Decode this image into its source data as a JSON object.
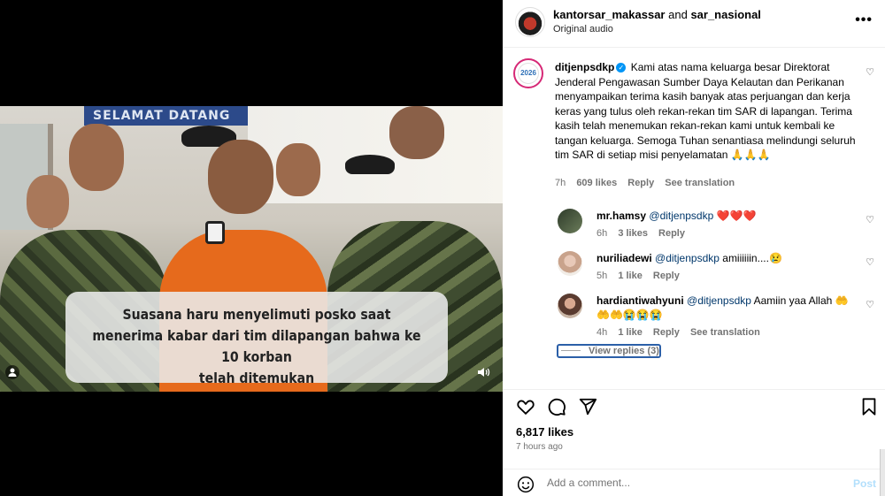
{
  "video": {
    "banner_text": "SELAMAT DATANG",
    "caption_lines": [
      "Suasana haru menyelimuti posko saat",
      "menerima kabar dari tim dilapangan bahwa ke 10 korban",
      "telah ditemukan"
    ],
    "user_tag_icon": "user-icon",
    "audio_icon": "speaker-icon"
  },
  "header": {
    "user1": "kantorsar_makassar",
    "joiner": "and",
    "user2": "sar_nasional",
    "subtitle": "Original audio",
    "more_icon": "more-icon"
  },
  "main_comment": {
    "username": "ditjenpsdkp",
    "avatar_text": "2026",
    "text": "Kami atas nama keluarga besar Direktorat Jenderal Pengawasan Sumber Daya Kelautan dan Perikanan menyampaikan terima kasih banyak atas perjuangan dan kerja keras yang tulus oleh rekan-rekan tim SAR di lapangan. Terima kasih telah menemukan rekan-rekan kami untuk kembali ke tangan keluarga. Semoga Tuhan senantiasa melindungi seluruh tim SAR di setiap misi penyelamatan 🙏🙏🙏",
    "time": "7h",
    "likes": "609 likes",
    "reply": "Reply",
    "translate": "See translation"
  },
  "replies": [
    {
      "username": "mr.hamsy",
      "mention": "@ditjenpsdkp",
      "text": "❤️❤️❤️",
      "time": "6h",
      "likes": "3 likes",
      "reply": "Reply",
      "translate": ""
    },
    {
      "username": "nuriliadewi",
      "mention": "@ditjenpsdkp",
      "text": "amiiiiiin....😢",
      "time": "5h",
      "likes": "1 like",
      "reply": "Reply",
      "translate": ""
    },
    {
      "username": "hardiantiwahyuni",
      "mention": "@ditjenpsdkp",
      "text": "Aamiin yaa Allah 🤲🤲🤲😭😭😭",
      "time": "4h",
      "likes": "1 like",
      "reply": "Reply",
      "translate": "See translation"
    }
  ],
  "view_replies": "View replies (3)",
  "post_stats": {
    "likes": "6,817 likes",
    "time": "7 hours ago"
  },
  "add_comment": {
    "placeholder": "Add a comment...",
    "post_label": "Post"
  },
  "colors": {
    "accent": "#0095f6",
    "mention": "#00376b",
    "muted": "#737373"
  }
}
